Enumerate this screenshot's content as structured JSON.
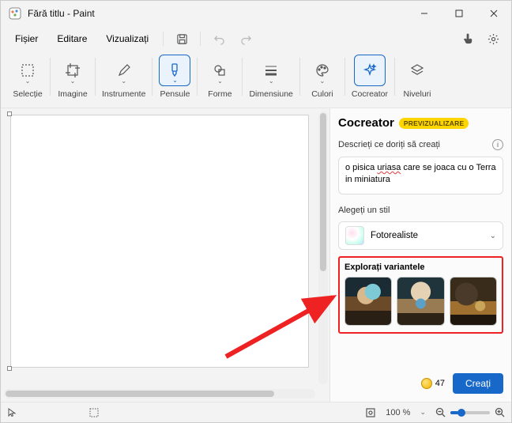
{
  "window": {
    "title": "Fără titlu - Paint"
  },
  "menu": {
    "file": "Fișier",
    "edit": "Editare",
    "view": "Vizualizați"
  },
  "ribbon": {
    "selection": "Selecție",
    "image": "Imagine",
    "tools": "Instrumente",
    "brushes": "Pensule",
    "shapes": "Forme",
    "size": "Dimensiune",
    "colors": "Culori",
    "cocreator": "Cocreator",
    "layers": "Niveluri"
  },
  "cocreator": {
    "title": "Cocreator",
    "badge": "PREVIZUALIZARE",
    "describe_label": "Descrieți ce doriți să creați",
    "prompt_pre": "o pisica ",
    "prompt_err": "uriasa",
    "prompt_post": " care se joaca cu o Terra in miniatura",
    "style_label": "Alegeți un stil",
    "style_value": "Fotorealiste",
    "variants_label": "Explorați variantele",
    "credits": "47",
    "create": "Creați"
  },
  "status": {
    "zoom": "100 %"
  }
}
